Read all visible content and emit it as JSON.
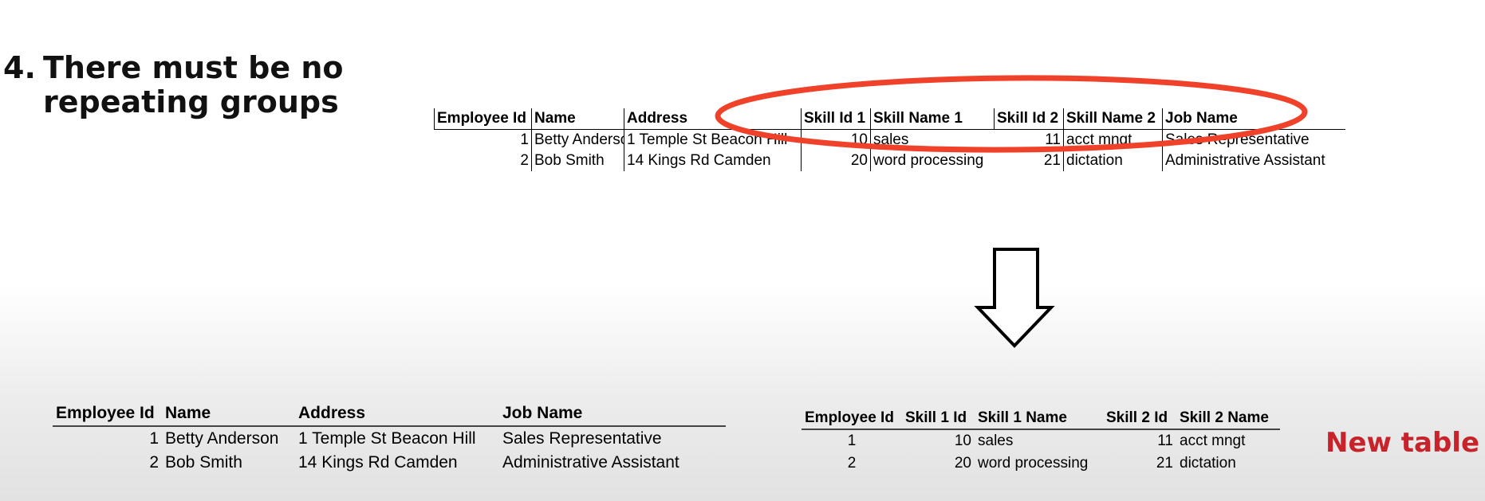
{
  "slide": {
    "heading_number": "4.",
    "heading_line1": "There must be no",
    "heading_line2": "repeating groups",
    "new_table_label": "New table"
  },
  "original_table": {
    "headers": [
      "Employee Id",
      "Name",
      "Address",
      "Skill Id 1",
      "Skill Name 1",
      "Skill Id 2",
      "Skill Name 2",
      "Job Name"
    ],
    "rows": [
      [
        "1",
        "Betty Anderson",
        "1 Temple St Beacon Hill",
        "10",
        "sales",
        "11",
        "acct mngt",
        "Sales Representative"
      ],
      [
        "2",
        "Bob Smith",
        "14 Kings Rd Camden",
        "20",
        "word processing",
        "21",
        "dictation",
        "Administrative Assistant"
      ]
    ]
  },
  "employee_table": {
    "headers": [
      "Employee Id",
      "Name",
      "Address",
      "Job Name"
    ],
    "rows": [
      [
        "1",
        "Betty Anderson",
        "1 Temple St Beacon Hill",
        "Sales Representative"
      ],
      [
        "2",
        "Bob Smith",
        "14 Kings Rd Camden",
        "Administrative Assistant"
      ]
    ]
  },
  "skill_table": {
    "headers": [
      "Employee Id",
      "Skill 1 Id",
      "Skill 1 Name",
      "Skill 2 Id",
      "Skill 2 Name"
    ],
    "rows": [
      [
        "1",
        "10",
        "sales",
        "11",
        "acct mngt"
      ],
      [
        "2",
        "20",
        "word processing",
        "21",
        "dictation"
      ]
    ]
  },
  "colors": {
    "highlight_ellipse": "#f0422a",
    "label_red": "#c8222a",
    "arrow_stroke": "#000000"
  },
  "icons": {
    "highlight": "ellipse-highlight-icon",
    "arrow": "down-arrow-icon"
  }
}
